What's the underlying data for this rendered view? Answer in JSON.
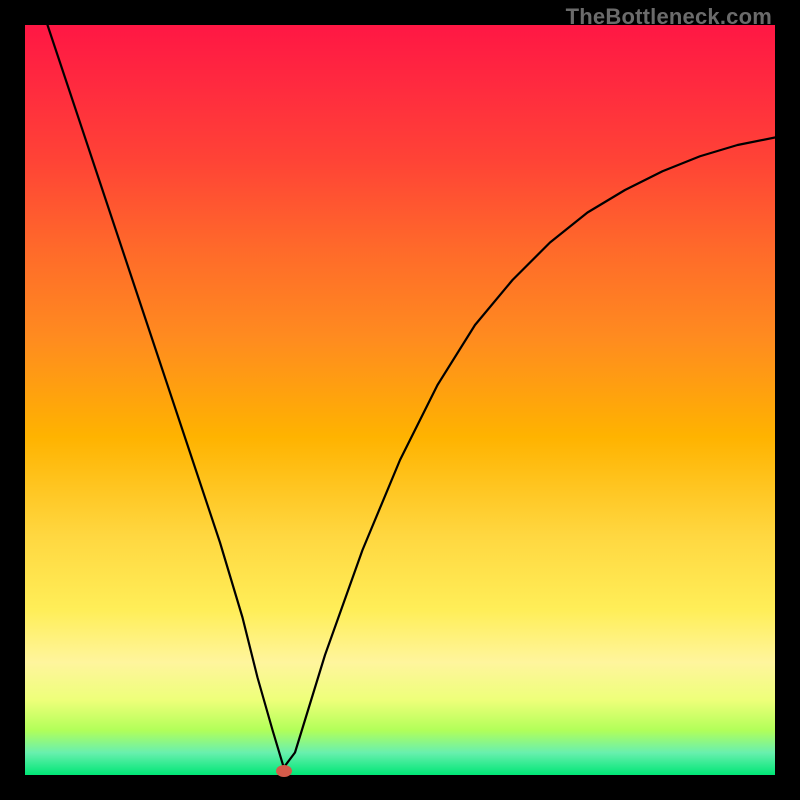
{
  "watermark": "TheBottleneck.com",
  "chart_data": {
    "type": "line",
    "title": "",
    "xlabel": "",
    "ylabel": "",
    "xlim": [
      0,
      100
    ],
    "ylim": [
      0,
      100
    ],
    "grid": false,
    "series": [
      {
        "name": "curve",
        "x": [
          3,
          6,
          10,
          14,
          18,
          22,
          26,
          29,
          31,
          33,
          34.5,
          36,
          40,
          45,
          50,
          55,
          60,
          65,
          70,
          75,
          80,
          85,
          90,
          95,
          100
        ],
        "y": [
          100,
          91,
          79,
          67,
          55,
          43,
          31,
          21,
          13,
          6,
          1,
          3,
          16,
          30,
          42,
          52,
          60,
          66,
          71,
          75,
          78,
          80.5,
          82.5,
          84,
          85
        ]
      }
    ],
    "marker": {
      "x": 34.5,
      "y": 0.5,
      "color": "#d35b4a"
    },
    "background_gradient": {
      "top": "#ff1744",
      "mid": "#ffd740",
      "bottom": "#00e676"
    }
  }
}
